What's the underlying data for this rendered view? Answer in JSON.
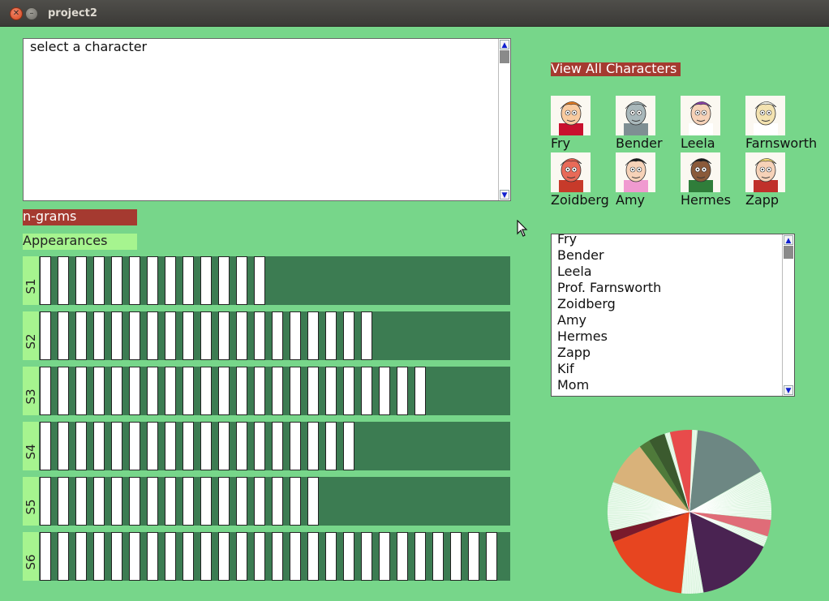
{
  "window": {
    "title": "project2"
  },
  "textarea": {
    "value": "select a character"
  },
  "buttons": {
    "ngrams": "n-grams",
    "appearances": "Appearances",
    "view_all": "View All Characters"
  },
  "seasons": [
    {
      "label": "S1",
      "episodes": 13,
      "capacity": 26
    },
    {
      "label": "S2",
      "episodes": 19,
      "capacity": 26
    },
    {
      "label": "S3",
      "episodes": 22,
      "capacity": 26
    },
    {
      "label": "S4",
      "episodes": 18,
      "capacity": 26
    },
    {
      "label": "S5",
      "episodes": 16,
      "capacity": 26
    },
    {
      "label": "S6",
      "episodes": 26,
      "capacity": 26
    }
  ],
  "characters": [
    {
      "name": "Fry",
      "hair": "#e37a1e",
      "skin": "#f8cba0",
      "shirt": "#c8102e"
    },
    {
      "name": "Bender",
      "hair": "#9fb0b4",
      "skin": "#a9b8bb",
      "shirt": "#7f8f93"
    },
    {
      "name": "Leela",
      "hair": "#8a3fa8",
      "skin": "#f6d2b8",
      "shirt": "#ffffff"
    },
    {
      "name": "Farnsworth",
      "hair": "#e9e9e0",
      "skin": "#f3e2b0",
      "shirt": "#ffffff"
    },
    {
      "name": "Zoidberg",
      "hair": "#e25a4a",
      "skin": "#e86a58",
      "shirt": "#c73a2a"
    },
    {
      "name": "Amy",
      "hair": "#1a1a1a",
      "skin": "#f6d2b8",
      "shirt": "#f09ad0"
    },
    {
      "name": "Hermes",
      "hair": "#1a1a1a",
      "skin": "#8a5a3a",
      "shirt": "#2f7d3a"
    },
    {
      "name": "Zapp",
      "hair": "#f0d870",
      "skin": "#f6d2b8",
      "shirt": "#c0302a"
    }
  ],
  "character_list": [
    "Fry",
    "Bender",
    "Leela",
    "Prof. Farnsworth",
    "Zoidberg",
    "Amy",
    "Hermes",
    "Zapp",
    "Kif",
    "Mom"
  ],
  "pie": {
    "slices": [
      {
        "value": 14,
        "color": "#6d8783"
      },
      {
        "value": 9,
        "color": "#d8f4dc",
        "striped": true
      },
      {
        "value": 3,
        "color": "#e06c78"
      },
      {
        "value": 2,
        "color": "#d8f4dc",
        "striped": true
      },
      {
        "value": 14,
        "color": "#4a2352"
      },
      {
        "value": 4,
        "color": "#d8f4dc",
        "striped": true
      },
      {
        "value": 16,
        "color": "#e74520"
      },
      {
        "value": 2,
        "color": "#7a1a2c"
      },
      {
        "value": 9,
        "color": "#d8f4dc",
        "striped": true
      },
      {
        "value": 8,
        "color": "#d9b27a"
      },
      {
        "value": 2,
        "color": "#4f7a3a"
      },
      {
        "value": 3,
        "color": "#3b5a2e"
      },
      {
        "value": 1,
        "color": "#d8f4dc",
        "striped": true
      },
      {
        "value": 4,
        "color": "#e84b4b"
      },
      {
        "value": 1,
        "color": "#d8f4dc",
        "striped": true
      }
    ]
  }
}
